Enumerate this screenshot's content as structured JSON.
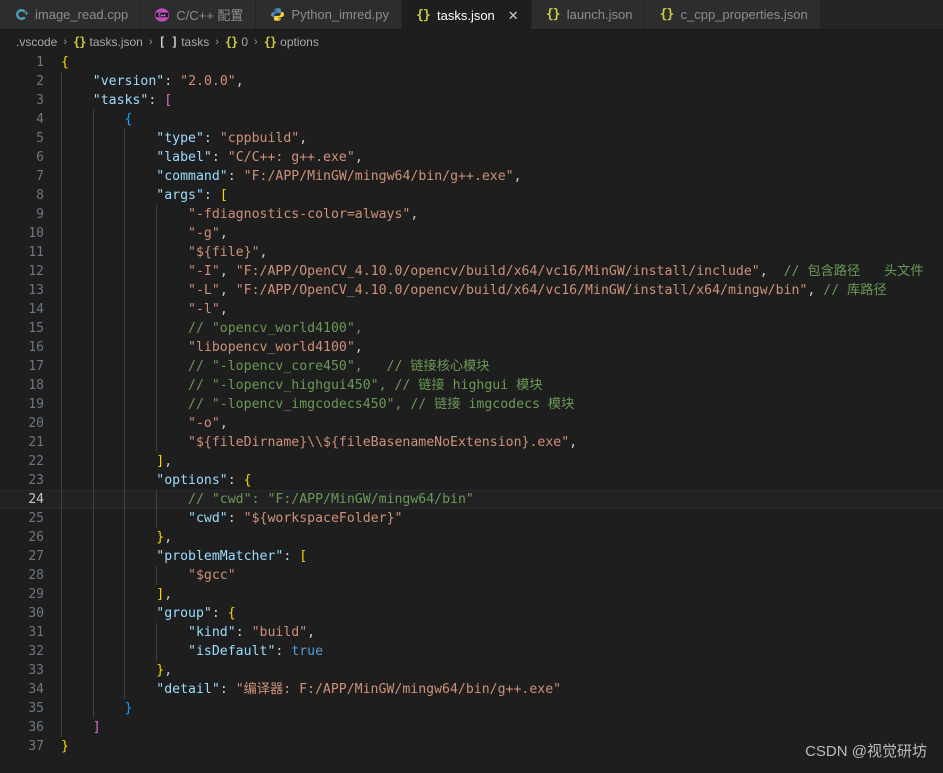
{
  "window": {
    "app": "Visual Studio Code",
    "theme_background": "#1e1e1e"
  },
  "tabs": [
    {
      "label": "image_read.cpp",
      "icon": "cpp-file-icon",
      "icon_glyph": "C+",
      "active": false,
      "closable": false
    },
    {
      "label": "C/C++ 配置",
      "icon": "cpp-config-icon",
      "icon_glyph": "C",
      "active": false,
      "closable": false
    },
    {
      "label": "Python_imred.py",
      "icon": "python-file-icon",
      "icon_glyph": "Py",
      "active": false,
      "closable": false
    },
    {
      "label": "tasks.json",
      "icon": "json-file-icon",
      "icon_glyph": "{}",
      "active": true,
      "closable": true,
      "close_label": "✕"
    },
    {
      "label": "launch.json",
      "icon": "json-file-icon",
      "icon_glyph": "{}",
      "active": false,
      "closable": false
    },
    {
      "label": "c_cpp_properties.json",
      "icon": "json-file-icon",
      "icon_glyph": "{}",
      "active": false,
      "closable": false
    }
  ],
  "breadcrumb": {
    "separator": "›",
    "items": [
      {
        "icon": "folder-icon",
        "icon_glyph": "",
        "label": ".vscode"
      },
      {
        "icon": "json-icon",
        "icon_glyph": "{}",
        "label": "tasks.json"
      },
      {
        "icon": "array-icon",
        "icon_glyph": "[ ]",
        "label": "tasks"
      },
      {
        "icon": "object-icon",
        "icon_glyph": "{}",
        "label": "0"
      },
      {
        "icon": "object-icon",
        "icon_glyph": "{}",
        "label": "options"
      }
    ]
  },
  "editor": {
    "language": "jsonc",
    "active_line": 24,
    "total_lines": 37,
    "line_numbers": [
      1,
      2,
      3,
      4,
      5,
      6,
      7,
      8,
      9,
      10,
      11,
      12,
      13,
      14,
      15,
      16,
      17,
      18,
      19,
      20,
      21,
      22,
      23,
      24,
      25,
      26,
      27,
      28,
      29,
      30,
      31,
      32,
      33,
      34,
      35,
      36,
      37
    ],
    "lines": [
      {
        "n": 1,
        "indent": 0,
        "text": "{"
      },
      {
        "n": 2,
        "indent": 1,
        "text": "\"version\": \"2.0.0\","
      },
      {
        "n": 3,
        "indent": 1,
        "text": "\"tasks\": ["
      },
      {
        "n": 4,
        "indent": 2,
        "text": "{"
      },
      {
        "n": 5,
        "indent": 3,
        "text": "\"type\": \"cppbuild\","
      },
      {
        "n": 6,
        "indent": 3,
        "text": "\"label\": \"C/C++: g++.exe\","
      },
      {
        "n": 7,
        "indent": 3,
        "text": "\"command\": \"F:/APP/MinGW/mingw64/bin/g++.exe\","
      },
      {
        "n": 8,
        "indent": 3,
        "text": "\"args\": ["
      },
      {
        "n": 9,
        "indent": 4,
        "text": "\"-fdiagnostics-color=always\","
      },
      {
        "n": 10,
        "indent": 4,
        "text": "\"-g\","
      },
      {
        "n": 11,
        "indent": 4,
        "text": "\"${file}\","
      },
      {
        "n": 12,
        "indent": 4,
        "text": "\"-I\", \"F:/APP/OpenCV_4.10.0/opencv/build/x64/vc16/MinGW/install/include\",  // 包含路径   头文件"
      },
      {
        "n": 13,
        "indent": 4,
        "text": "\"-L\", \"F:/APP/OpenCV_4.10.0/opencv/build/x64/vc16/MinGW/install/x64/mingw/bin\", // 库路径"
      },
      {
        "n": 14,
        "indent": 4,
        "text": "\"-l\","
      },
      {
        "n": 15,
        "indent": 4,
        "text": "// \"opencv_world4100\","
      },
      {
        "n": 16,
        "indent": 4,
        "text": "\"libopencv_world4100\","
      },
      {
        "n": 17,
        "indent": 4,
        "text": "// \"-lopencv_core450\",   // 链接核心模块"
      },
      {
        "n": 18,
        "indent": 4,
        "text": "// \"-lopencv_highgui450\", // 链接 highgui 模块"
      },
      {
        "n": 19,
        "indent": 4,
        "text": "// \"-lopencv_imgcodecs450\", // 链接 imgcodecs 模块"
      },
      {
        "n": 20,
        "indent": 4,
        "text": "\"-o\","
      },
      {
        "n": 21,
        "indent": 4,
        "text": "\"${fileDirname}\\\\${fileBasenameNoExtension}.exe\","
      },
      {
        "n": 22,
        "indent": 3,
        "text": "],"
      },
      {
        "n": 23,
        "indent": 3,
        "text": "\"options\": {"
      },
      {
        "n": 24,
        "indent": 4,
        "text": "// \"cwd\": \"F:/APP/MinGW/mingw64/bin\""
      },
      {
        "n": 25,
        "indent": 4,
        "text": "\"cwd\": \"${workspaceFolder}\""
      },
      {
        "n": 26,
        "indent": 3,
        "text": "},"
      },
      {
        "n": 27,
        "indent": 3,
        "text": "\"problemMatcher\": ["
      },
      {
        "n": 28,
        "indent": 4,
        "text": "\"$gcc\""
      },
      {
        "n": 29,
        "indent": 3,
        "text": "],"
      },
      {
        "n": 30,
        "indent": 3,
        "text": "\"group\": {"
      },
      {
        "n": 31,
        "indent": 4,
        "text": "\"kind\": \"build\","
      },
      {
        "n": 32,
        "indent": 4,
        "text": "\"isDefault\": true"
      },
      {
        "n": 33,
        "indent": 3,
        "text": "},"
      },
      {
        "n": 34,
        "indent": 3,
        "text": "\"detail\": \"编译器: F:/APP/MinGW/mingw64/bin/g++.exe\""
      },
      {
        "n": 35,
        "indent": 2,
        "text": "}"
      },
      {
        "n": 36,
        "indent": 1,
        "text": "]"
      },
      {
        "n": 37,
        "indent": 0,
        "text": "}"
      }
    ]
  },
  "watermark": {
    "text": "CSDN @视觉研坊"
  },
  "colors": {
    "background": "#1e1e1e",
    "tabbar_background": "#252526",
    "tab_inactive": "#2d2d2d",
    "key": "#9cdcfe",
    "string": "#ce9178",
    "comment": "#6a9955",
    "boolean": "#569cd6",
    "bracket_l0": "#ffd700",
    "bracket_l1": "#da70d6",
    "bracket_l2": "#179fff",
    "line_number": "#6e7681",
    "active_line_number": "#c6c6c6"
  }
}
